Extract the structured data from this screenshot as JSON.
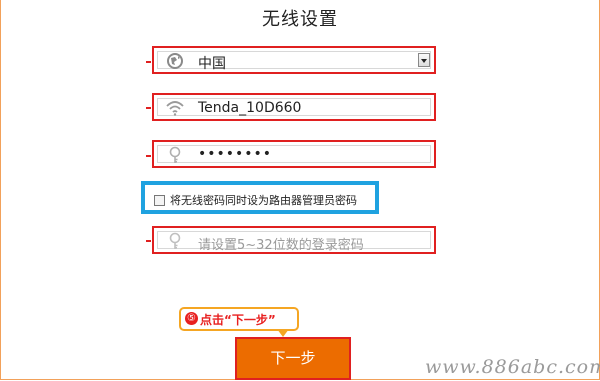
{
  "page": {
    "title": "无线设置"
  },
  "region": {
    "value": "中国",
    "icon": "globe-icon"
  },
  "ssid": {
    "value": "Tenda_10D660",
    "icon": "wifi-icon"
  },
  "wifi_password": {
    "value": "••••••••",
    "icon": "key-icon"
  },
  "same_password_checkbox": {
    "label": "将无线密码同时设为路由器管理员密码",
    "checked": false
  },
  "admin_password": {
    "placeholder": "请设置5~32位数的登录密码",
    "icon": "key-icon"
  },
  "callout": {
    "number": "⑤",
    "text": "点击“下一步”"
  },
  "next_button": {
    "label": "下一步"
  },
  "watermark": {
    "text": "www.886abc.com"
  },
  "colors": {
    "highlight_red": "#e02020",
    "highlight_blue": "#1fa2e0",
    "button_orange": "#ec6c00",
    "callout_border": "#f5a623"
  }
}
